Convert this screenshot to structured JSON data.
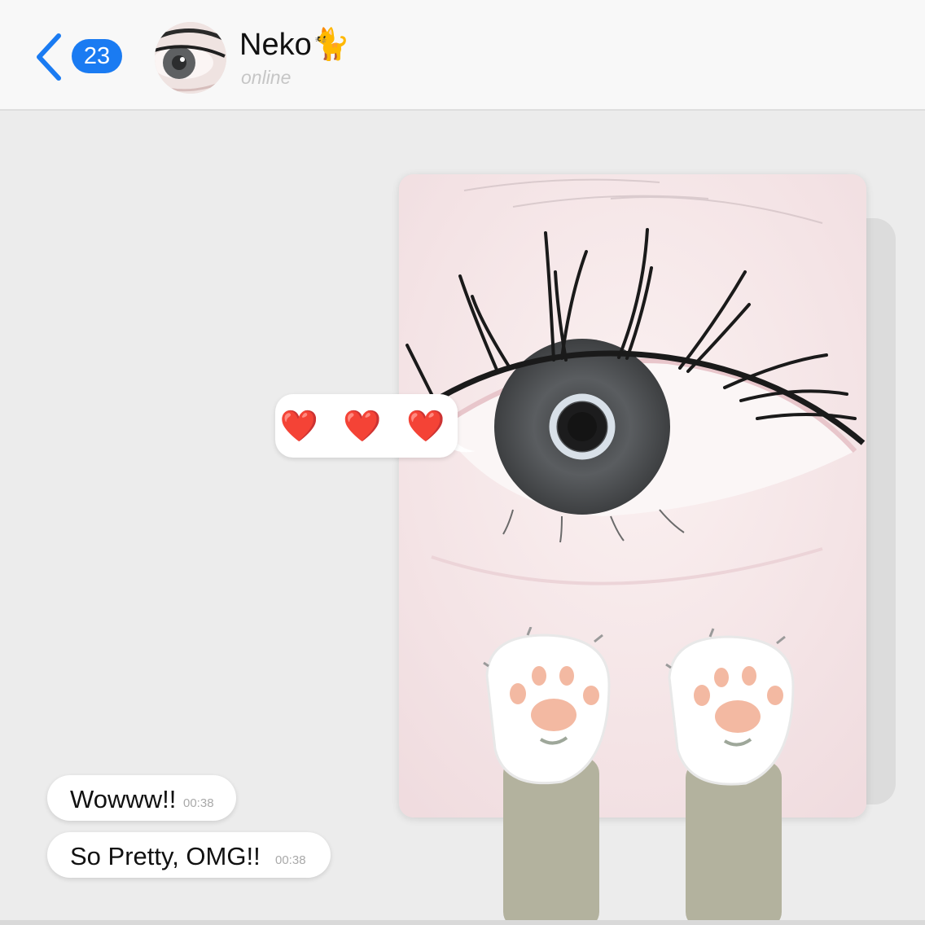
{
  "header": {
    "unread_count": "23",
    "contact_name": "Neko🐈",
    "status": "online"
  },
  "reaction": {
    "text": "❤️ ❤️ ❤️"
  },
  "messages": [
    {
      "text": "Wowww!!",
      "time": "00:38"
    },
    {
      "text": "So Pretty, OMG!!",
      "time": "00:38"
    }
  ],
  "icons": [
    "back-chevron-icon",
    "heart-icon",
    "paw-icon"
  ],
  "colors": {
    "accent": "#1a7bf2",
    "heart": "#e0202e",
    "background": "#ececec"
  }
}
